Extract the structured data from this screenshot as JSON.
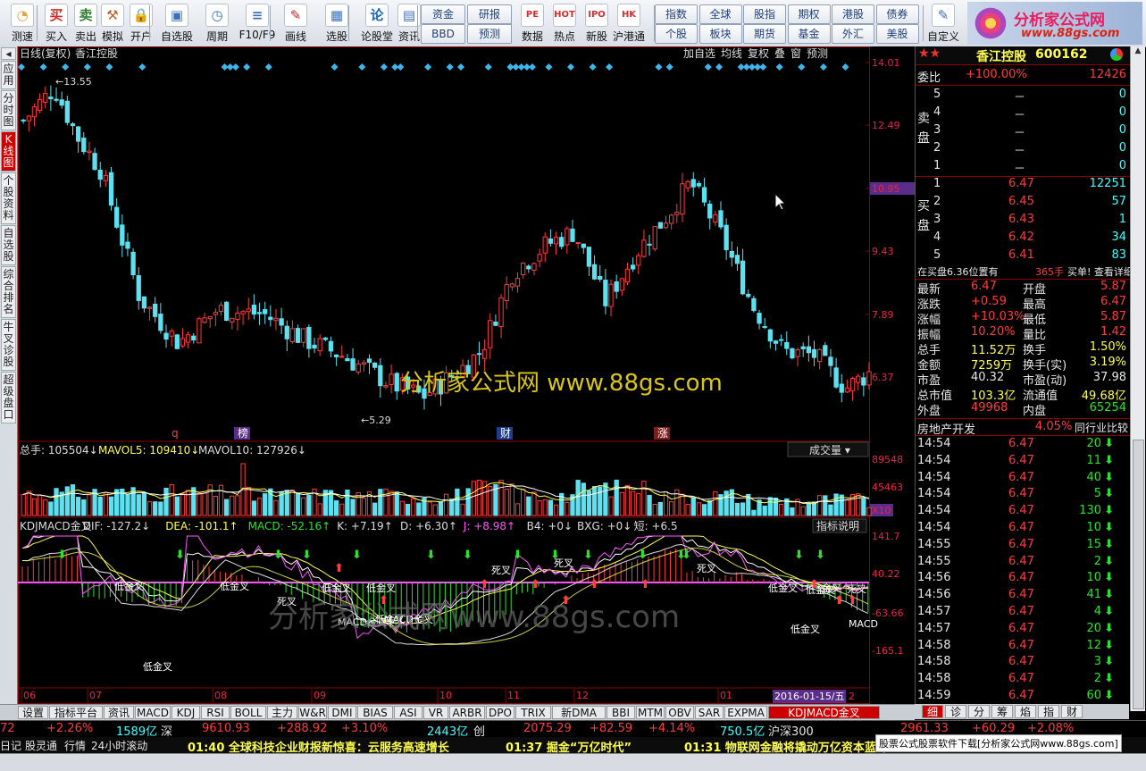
{
  "toolbar": {
    "buttons": [
      {
        "label": "测速",
        "icon": "clock-icon"
      },
      {
        "label": "买入",
        "icon": "buy-icon"
      },
      {
        "label": "卖出",
        "icon": "sell-icon"
      },
      {
        "label": "模拟",
        "icon": "hammer-icon"
      },
      {
        "label": "开户",
        "icon": "lock-icon"
      },
      {
        "label": "自选股",
        "icon": "add-stock-icon"
      },
      {
        "label": "周期",
        "icon": "period-icon"
      },
      {
        "label": "F10/F9",
        "icon": "f10-icon"
      },
      {
        "label": "画线",
        "icon": "pen-icon"
      },
      {
        "label": "选股",
        "icon": "select-stock-icon"
      },
      {
        "label": "论股堂",
        "icon": "forum-icon"
      },
      {
        "label": "资讯",
        "icon": "news-icon"
      }
    ],
    "grid1": [
      "资金",
      "研报",
      "BBD",
      "预测"
    ],
    "grid2": [
      "数据",
      "热点",
      "新股",
      "沪港通"
    ],
    "grid3": [
      "指数",
      "全球",
      "股指",
      "期权",
      "港股",
      "债券",
      "个股",
      "板块",
      "期货",
      "基金",
      "外汇",
      "美股"
    ],
    "custom_label": "自定义",
    "logo_line1": "分析家公式网",
    "logo_line2": "www.88gs.com"
  },
  "left_tabs": [
    "应用",
    "分时图",
    "K线图",
    "个股资料",
    "自选股",
    "综合排名",
    "牛叉诊股",
    "超级盘口"
  ],
  "chart": {
    "title": "日线(复权)",
    "stock": "香江控股",
    "right_buttons": [
      "加自选",
      "均线",
      "复权",
      "叠",
      "窗",
      "预测"
    ],
    "price_axis": [
      "14.01",
      "12.49",
      "10.95",
      "9.43",
      "7.89",
      "6.37"
    ],
    "high_label": "13.55",
    "low_label": "5.29",
    "markers": [
      "q",
      "榜",
      "财",
      "涨"
    ],
    "vol_header": {
      "label": "总手:",
      "v": "105504",
      "ma5_label": "MAVOL5:",
      "ma5": "109410",
      "ma10_label": "MAVOL10:",
      "ma10": "127926"
    },
    "vol_dropdown": "成交量",
    "vol_axis": [
      "89548",
      "45463",
      "X10"
    ],
    "ind_header": {
      "name": "KDJMACD金叉",
      "dif_label": "DIF:",
      "dif": "-127.2",
      "dea_label": "DEA:",
      "dea": "-101.1",
      "macd_label": "MACD:",
      "macd": "-52.16",
      "k_label": "K:",
      "k": "+7.19",
      "d_label": "D:",
      "d": "+6.30",
      "j_label": "J:",
      "j": "+8.98",
      "b4_label": "B4:",
      "b4": "+0",
      "bxg_label": "BXG:",
      "bxg": "+0",
      "short_label": "短:",
      "short": "+6.5"
    },
    "ind_button": "指标说明",
    "ind_axis": [
      "141.7",
      "40.22",
      "-63.66",
      "-165.1"
    ],
    "ind_labels": [
      "低金叉",
      "低金叉",
      "低金叉",
      "低金叉",
      "低金叉",
      "死叉",
      "低金叉",
      "MACD金叉",
      "MACD金叉",
      "死叉",
      "死叉",
      "死叉",
      "低金叉",
      "低金叉",
      "金叉",
      "低金叉",
      "死叉",
      "MACD"
    ],
    "months": [
      "06",
      "07",
      "08",
      "09",
      "10",
      "11",
      "12",
      "01"
    ],
    "date_highlight": "2016-01-15/五",
    "date_end": "2",
    "watermark": "分析家公式网  www.88gs.com",
    "watermark2": "分析家公式网www.88gs.com"
  },
  "panel": {
    "stock_name": "香江控股",
    "stock_code": "600162",
    "wei_label": "委比",
    "wei_value": "+100.00%",
    "wei_diff": "12426",
    "sell_label": "卖盘",
    "buy_label": "买盘",
    "sell": [
      {
        "n": "5",
        "p": "－",
        "v": "0"
      },
      {
        "n": "4",
        "p": "－",
        "v": "0"
      },
      {
        "n": "3",
        "p": "－",
        "v": "0"
      },
      {
        "n": "2",
        "p": "－",
        "v": "0"
      },
      {
        "n": "1",
        "p": "－",
        "v": "0"
      }
    ],
    "buy": [
      {
        "n": "1",
        "p": "6.47",
        "v": "12251"
      },
      {
        "n": "2",
        "p": "6.45",
        "v": "57"
      },
      {
        "n": "3",
        "p": "6.43",
        "v": "1"
      },
      {
        "n": "4",
        "p": "6.42",
        "v": "34"
      },
      {
        "n": "5",
        "p": "6.41",
        "v": "83"
      }
    ],
    "note_left": "在买盘6.36位置有",
    "note_mid": "365手",
    "note_right": "买单! 查看详细",
    "stats": [
      {
        "l1": "最新",
        "v1": "6.47",
        "l2": "开盘",
        "v2": "5.87"
      },
      {
        "l1": "涨跌",
        "v1": "+0.59",
        "l2": "最高",
        "v2": "6.47"
      },
      {
        "l1": "涨幅",
        "v1": "+10.03%",
        "l2": "最低",
        "v2": "5.87"
      },
      {
        "l1": "振幅",
        "v1": "10.20%",
        "l2": "量比",
        "v2": "1.42"
      },
      {
        "l1": "总手",
        "v1": "11.52万",
        "l2": "换手",
        "v2": "1.50%"
      },
      {
        "l1": "金额",
        "v1": "7259万",
        "l2": "换手(实)",
        "v2": "3.19%"
      },
      {
        "l1": "市盈",
        "v1": "40.32",
        "l2": "市盈(动)",
        "v2": "37.98"
      },
      {
        "l1": "总市值",
        "v1": "103.3亿",
        "l2": "流通值",
        "v2": "49.68亿"
      },
      {
        "l1": "外盘",
        "v1": "49968",
        "l2": "内盘",
        "v2": "65254"
      }
    ],
    "sector_name": "房地产开发",
    "sector_pct": "4.05%",
    "sector_btn": "同行业比较",
    "ticks": [
      {
        "t": "14:54",
        "p": "6.47",
        "v": "20"
      },
      {
        "t": "14:54",
        "p": "6.47",
        "v": "11"
      },
      {
        "t": "14:54",
        "p": "6.47",
        "v": "40"
      },
      {
        "t": "14:54",
        "p": "6.47",
        "v": "5"
      },
      {
        "t": "14:54",
        "p": "6.47",
        "v": "130"
      },
      {
        "t": "14:54",
        "p": "6.47",
        "v": "10"
      },
      {
        "t": "14:55",
        "p": "6.47",
        "v": "15"
      },
      {
        "t": "14:55",
        "p": "6.47",
        "v": "2"
      },
      {
        "t": "14:56",
        "p": "6.47",
        "v": "10"
      },
      {
        "t": "14:56",
        "p": "6.47",
        "v": "41"
      },
      {
        "t": "14:57",
        "p": "6.47",
        "v": "4"
      },
      {
        "t": "14:57",
        "p": "6.47",
        "v": "20"
      },
      {
        "t": "14:58",
        "p": "6.47",
        "v": "12"
      },
      {
        "t": "14:58",
        "p": "6.47",
        "v": "3"
      },
      {
        "t": "14:58",
        "p": "6.47",
        "v": "2"
      },
      {
        "t": "14:59",
        "p": "6.47",
        "v": "60"
      }
    ]
  },
  "bottom_tabs": [
    "设置",
    "指标平台",
    "资讯",
    "MACD",
    "KDJ",
    "RSI",
    "BOLL",
    "主力",
    "W&R",
    "DMI",
    "BIAS",
    "ASI",
    "VR",
    "ARBR",
    "DPO",
    "TRIX",
    "新DMA",
    "BBI",
    "MTM",
    "OBV",
    "SAR",
    "EXPMA",
    "KDJMACD金叉"
  ],
  "right_tabs": [
    "细",
    "诊",
    "分",
    "筹",
    "焰",
    "指",
    "财"
  ],
  "ticker": [
    {
      "text": "72",
      "cls": "red"
    },
    {
      "text": "+2.26%",
      "cls": "red"
    },
    {
      "text": "1589亿",
      "cls": "cyn"
    },
    {
      "text": "深",
      "cls": "wht"
    },
    {
      "text": "9610.93",
      "cls": "red"
    },
    {
      "text": "+288.92",
      "cls": "red"
    },
    {
      "text": "+3.10%",
      "cls": "red"
    },
    {
      "text": "2443亿",
      "cls": "cyn"
    },
    {
      "text": "创",
      "cls": "wht"
    },
    {
      "text": "2075.29",
      "cls": "red"
    },
    {
      "text": "+82.59",
      "cls": "red"
    },
    {
      "text": "+4.14%",
      "cls": "red"
    },
    {
      "text": "750.5亿",
      "cls": "cyn"
    },
    {
      "text": "沪深300",
      "cls": "wht"
    },
    {
      "text": "2961.33",
      "cls": "red"
    },
    {
      "text": "+60.29",
      "cls": "red"
    },
    {
      "text": "+2.08%",
      "cls": "red"
    }
  ],
  "news": {
    "tabs": [
      "日记",
      "股灵通",
      "行情",
      "24小时滚动"
    ],
    "items": [
      "01:40 全球科技企业财报新惊喜：云服务高速增长",
      "01:37 掘金“万亿时代”",
      "01:31 物联网金融将撬动万亿资本蓝海"
    ],
    "banner": "股票公式股票软件下载[分析家公式网www.88gs.com]"
  }
}
